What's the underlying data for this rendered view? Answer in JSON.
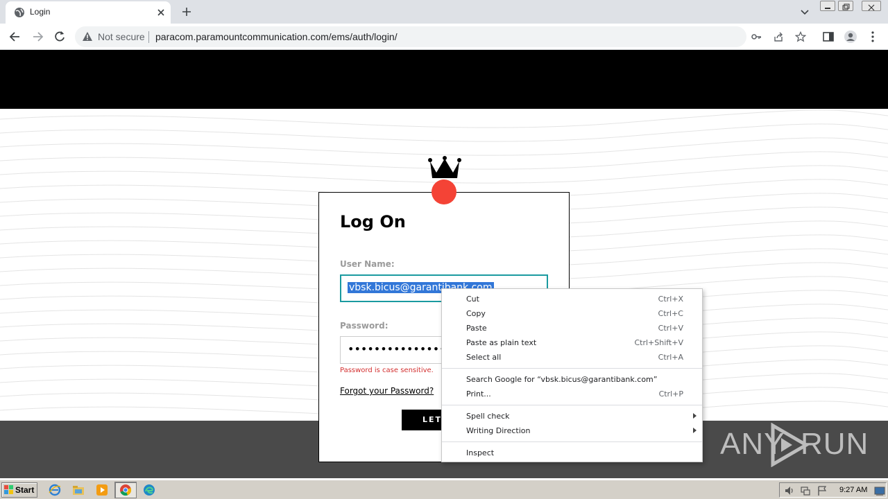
{
  "browser": {
    "tab_title": "Login",
    "security_label": "Not secure",
    "url": "paracom.paramountcommunication.com/ems/auth/login/"
  },
  "login": {
    "title": "Log On",
    "username_label": "User Name:",
    "username_value": "vbsk.bicus@garantibank.com",
    "password_label": "Password:",
    "password_value": "••••••••••••••••••••••••",
    "password_hint": "Password is case sensitive.",
    "forgot_link": "Forgot your Password?",
    "submit_label": "LET'S GO"
  },
  "context_menu": {
    "groups": [
      [
        {
          "label": "Cut",
          "shortcut": "Ctrl+X"
        },
        {
          "label": "Copy",
          "shortcut": "Ctrl+C"
        },
        {
          "label": "Paste",
          "shortcut": "Ctrl+V"
        },
        {
          "label": "Paste as plain text",
          "shortcut": "Ctrl+Shift+V"
        },
        {
          "label": "Select all",
          "shortcut": "Ctrl+A"
        }
      ],
      [
        {
          "label": "Search Google for “vbsk.bicus@garantibank.com”",
          "shortcut": ""
        },
        {
          "label": "Print...",
          "shortcut": "Ctrl+P"
        }
      ],
      [
        {
          "label": "Spell check",
          "shortcut": "",
          "submenu": true
        },
        {
          "label": "Writing Direction",
          "shortcut": "",
          "submenu": true
        }
      ],
      [
        {
          "label": "Inspect",
          "shortcut": ""
        }
      ]
    ]
  },
  "watermark": {
    "left": "ANY",
    "right": "RUN"
  },
  "taskbar": {
    "start_label": "Start",
    "clock": "9:27 AM",
    "apps": [
      "ie-icon",
      "explorer-icon",
      "media-player-icon",
      "chrome-icon",
      "edge-icon"
    ]
  },
  "colors": {
    "header": "#000000",
    "footer": "#4a4a4a",
    "accent_focus": "#1a9aa0",
    "selection": "#3277d8",
    "error": "#d32f2f",
    "brand_dot": "#f44336"
  }
}
